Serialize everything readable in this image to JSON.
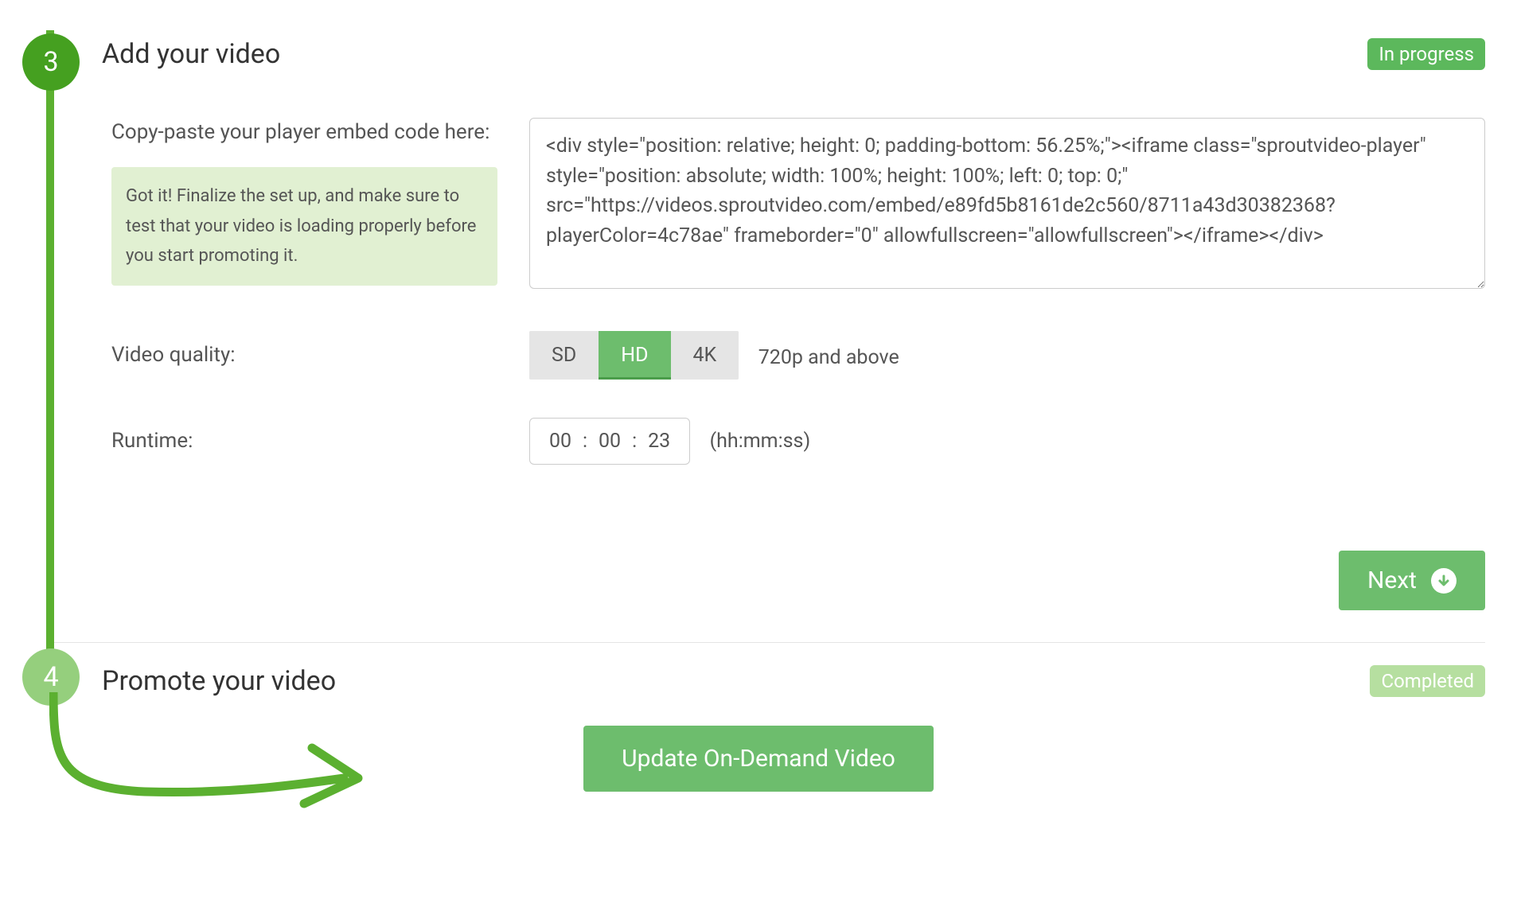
{
  "step3": {
    "number": "3",
    "title": "Add your video",
    "status": "In progress",
    "embed_label": "Copy-paste your player embed code here:",
    "embed_tip": "Got it! Finalize the set up, and make sure to test that your video is loading properly before you start promoting it.",
    "embed_value": "<div style=\"position: relative; height: 0; padding-bottom: 56.25%;\"><iframe class=\"sproutvideo-player\" style=\"position: absolute; width: 100%; height: 100%; left: 0; top: 0;\" src=\"https://videos.sproutvideo.com/embed/e89fd5b8161de2c560/8711a43d30382368?playerColor=4c78ae\" frameborder=\"0\" allowfullscreen=\"allowfullscreen\"></iframe></div>",
    "quality_label": "Video quality:",
    "quality_options": {
      "sd": "SD",
      "hd": "HD",
      "fourk": "4K"
    },
    "quality_hint": "720p and above",
    "runtime_label": "Runtime:",
    "runtime": {
      "hh": "00",
      "mm": "00",
      "ss": "23",
      "sep": ":"
    },
    "runtime_hint": "(hh:mm:ss)",
    "next_label": "Next"
  },
  "step4": {
    "number": "4",
    "title": "Promote your video",
    "status": "Completed"
  },
  "update_button": "Update On-Demand Video"
}
